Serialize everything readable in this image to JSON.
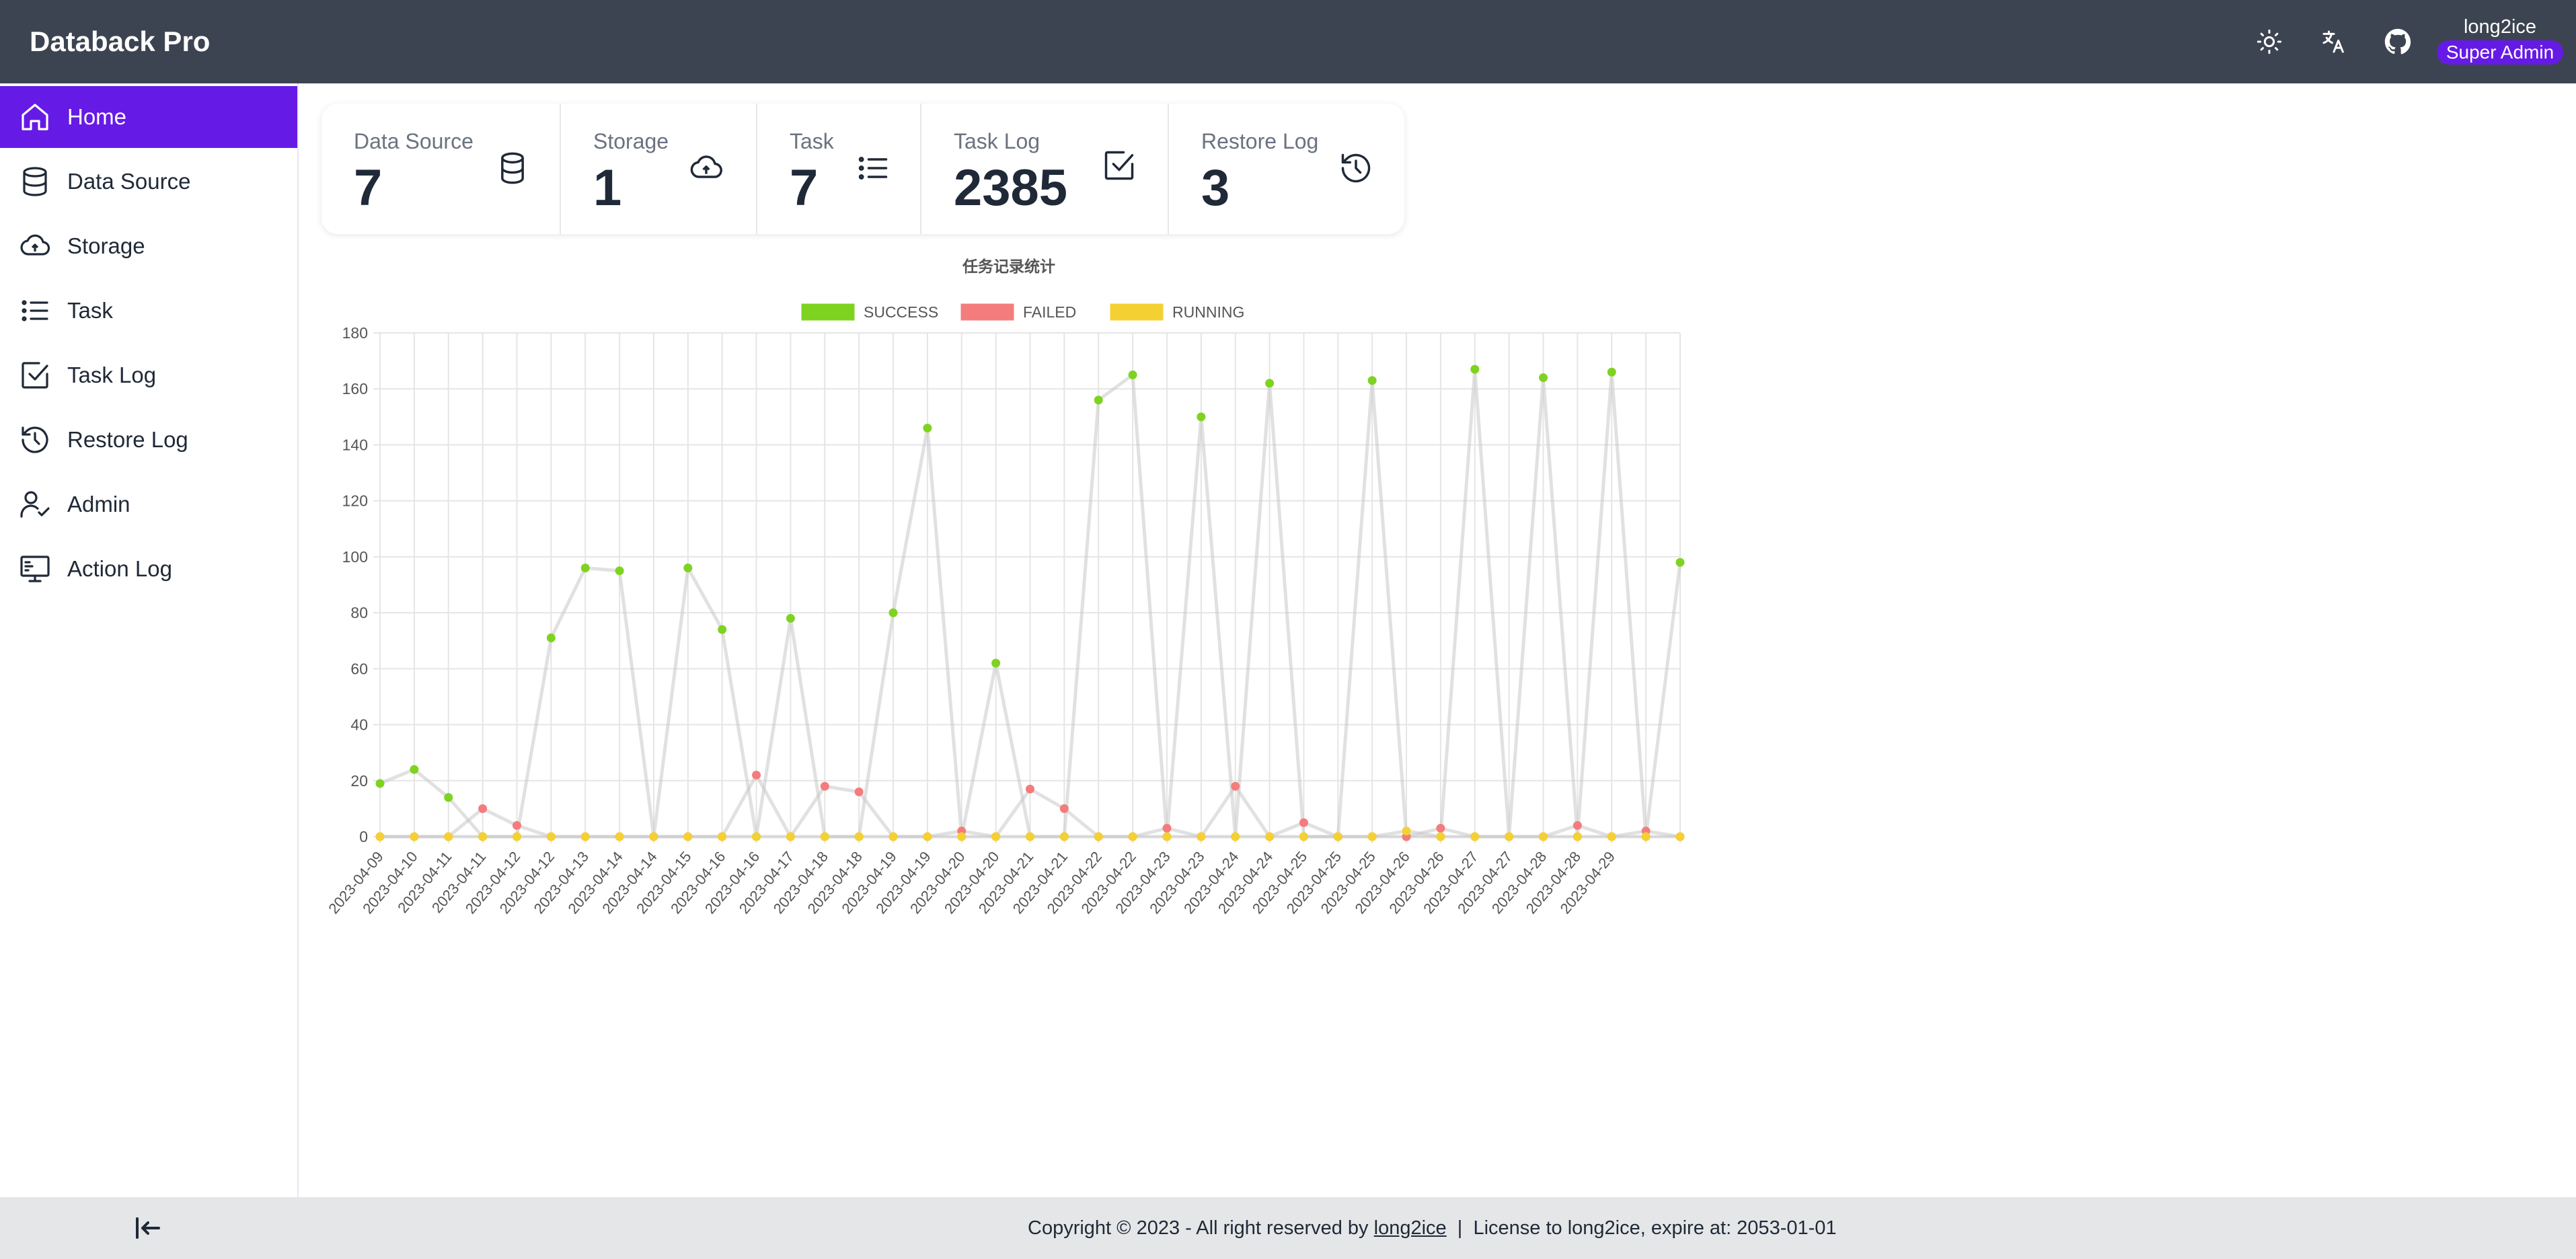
{
  "app": {
    "title": "Databack Pro"
  },
  "header": {
    "icons": [
      "theme-sun-icon",
      "translate-icon",
      "github-icon"
    ],
    "user": {
      "name": "long2ice",
      "role": "Super Admin"
    }
  },
  "sidebar": {
    "items": [
      {
        "label": "Home",
        "icon": "home-icon",
        "active": true
      },
      {
        "label": "Data Source",
        "icon": "database-icon"
      },
      {
        "label": "Storage",
        "icon": "cloud-icon"
      },
      {
        "label": "Task",
        "icon": "list-icon"
      },
      {
        "label": "Task Log",
        "icon": "checkbox-icon"
      },
      {
        "label": "Restore Log",
        "icon": "history-icon"
      },
      {
        "label": "Admin",
        "icon": "user-check-icon"
      },
      {
        "label": "Action Log",
        "icon": "monitor-icon"
      }
    ]
  },
  "stats": [
    {
      "title": "Data Source",
      "value": "7",
      "icon": "database-icon"
    },
    {
      "title": "Storage",
      "value": "1",
      "icon": "cloud-icon"
    },
    {
      "title": "Task",
      "value": "7",
      "icon": "list-icon"
    },
    {
      "title": "Task Log",
      "value": "2385",
      "icon": "checkbox-icon"
    },
    {
      "title": "Restore Log",
      "value": "3",
      "icon": "history-icon"
    }
  ],
  "colors": {
    "primary": "#661ae6",
    "topbar": "#3d4451",
    "success": "#7ed321",
    "failed": "#f47c7c",
    "running": "#f5d033"
  },
  "chart_data": {
    "type": "line",
    "title": "任务记录统计",
    "legend_position": "top",
    "grid": true,
    "ylim": [
      0,
      180
    ],
    "yticks": [
      0,
      20,
      40,
      60,
      80,
      100,
      120,
      140,
      160,
      180
    ],
    "categories": [
      "2023-04-09",
      "2023-04-10",
      "2023-04-11",
      "2023-04-11",
      "2023-04-12",
      "2023-04-12",
      "2023-04-13",
      "2023-04-14",
      "2023-04-14",
      "2023-04-15",
      "2023-04-16",
      "2023-04-16",
      "2023-04-17",
      "2023-04-18",
      "2023-04-18",
      "2023-04-19",
      "2023-04-19",
      "2023-04-20",
      "2023-04-20",
      "2023-04-21",
      "2023-04-21",
      "2023-04-22",
      "2023-04-22",
      "2023-04-23",
      "2023-04-23",
      "2023-04-24",
      "2023-04-24",
      "2023-04-25",
      "2023-04-25",
      "2023-04-25",
      "2023-04-26",
      "2023-04-26",
      "2023-04-27",
      "2023-04-27",
      "2023-04-28",
      "2023-04-28",
      "2023-04-29"
    ],
    "series": [
      {
        "name": "SUCCESS",
        "color": "#7ed321",
        "values": [
          19,
          24,
          14,
          0,
          0,
          71,
          96,
          95,
          0,
          96,
          74,
          0,
          78,
          0,
          0,
          80,
          146,
          0,
          62,
          0,
          0,
          156,
          165,
          0,
          150,
          0,
          162,
          0,
          0,
          163,
          0,
          0,
          167,
          0,
          164,
          0,
          166,
          0,
          98
        ]
      },
      {
        "name": "FAILED",
        "color": "#f47c7c",
        "values": [
          0,
          0,
          0,
          10,
          4,
          0,
          0,
          0,
          0,
          0,
          0,
          22,
          0,
          18,
          16,
          0,
          0,
          2,
          0,
          17,
          10,
          0,
          0,
          3,
          0,
          18,
          0,
          5,
          0,
          0,
          0,
          3,
          0,
          0,
          0,
          4,
          0,
          2,
          0
        ]
      },
      {
        "name": "RUNNING",
        "color": "#f5d033",
        "values": [
          0,
          0,
          0,
          0,
          0,
          0,
          0,
          0,
          0,
          0,
          0,
          0,
          0,
          0,
          0,
          0,
          0,
          0,
          0,
          0,
          0,
          0,
          0,
          0,
          0,
          0,
          0,
          0,
          0,
          0,
          2,
          0,
          0,
          0,
          0,
          0,
          0,
          0,
          0
        ]
      }
    ]
  },
  "footer": {
    "copyright_prefix": "Copyright © 2023 - All right reserved by",
    "author": "long2ice",
    "license": "License to long2ice, expire at: 2053-01-01"
  }
}
